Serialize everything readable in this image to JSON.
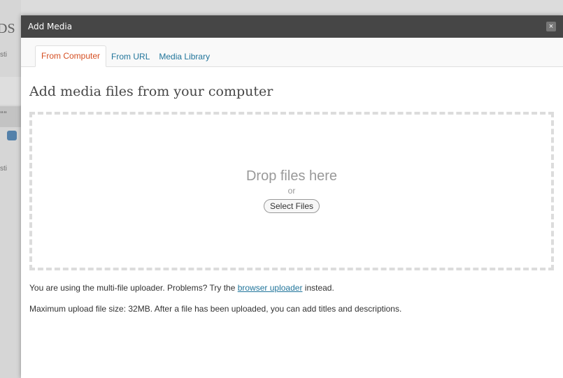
{
  "modal": {
    "title": "Add Media",
    "close_label": "×",
    "tabs": [
      {
        "label": "From Computer",
        "active": true
      },
      {
        "label": "From URL",
        "active": false
      },
      {
        "label": "Media Library",
        "active": false
      }
    ],
    "heading": "Add media files from your computer",
    "dropzone": {
      "title": "Drop files here",
      "or": "or",
      "select_label": "Select Files"
    },
    "uploader_note": {
      "before": "You are using the multi-file uploader. Problems? Try the ",
      "link": "browser uploader",
      "after": " instead."
    },
    "max_size_note": "Maximum upload file size: 32MB. After a file has been uploaded, you can add titles and descriptions."
  },
  "background": {
    "fragments": [
      "DS",
      "sti",
      "““",
      "sti"
    ]
  },
  "colors": {
    "titlebar": "#464646",
    "active_tab": "#d54e21",
    "link": "#21759b"
  }
}
